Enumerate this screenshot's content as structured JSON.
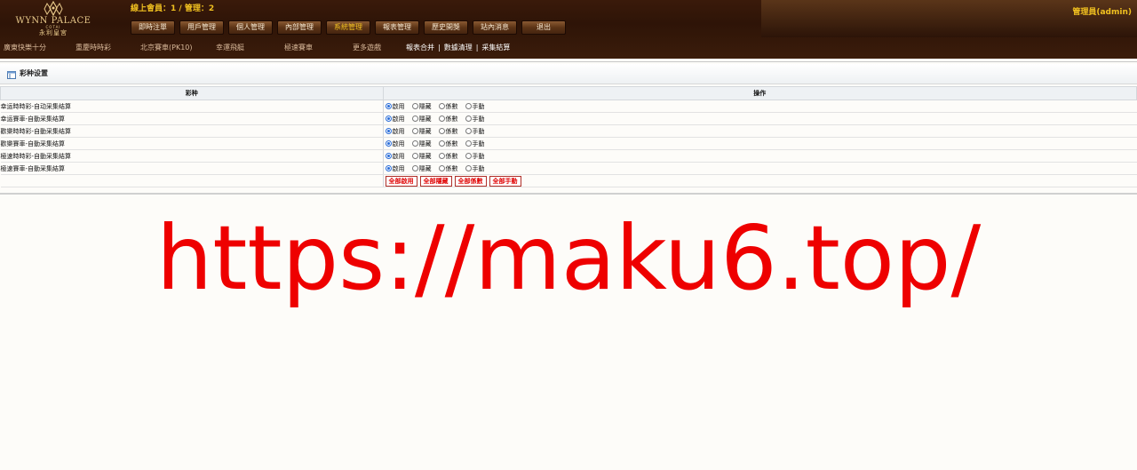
{
  "header": {
    "logo": {
      "brand_en": "WYNN PALACE",
      "brand_sub": "COTAI",
      "brand_cn": "永利皇宮"
    },
    "online_status": "線上會員：1 / 管理：2",
    "admin_label": "管理員(admin)"
  },
  "nav": [
    {
      "label": "即時注單",
      "active": false
    },
    {
      "label": "用戶管理",
      "active": false
    },
    {
      "label": "個人管理",
      "active": false
    },
    {
      "label": "內部管理",
      "active": false
    },
    {
      "label": "系統管理",
      "active": true
    },
    {
      "label": "報表管理",
      "active": false
    },
    {
      "label": "歷史開獎",
      "active": false
    },
    {
      "label": "站內消息",
      "active": false
    },
    {
      "label": "退出",
      "active": false
    }
  ],
  "lottery_links": [
    "廣東快樂十分",
    "重慶時時彩",
    "北京賽車(PK10)",
    "幸運飛艇",
    "極速賽車",
    "更多遊戲"
  ],
  "subnav_links": [
    "報表合并",
    "數據清理",
    "采集結算"
  ],
  "panel": {
    "title": "彩种设置",
    "columns": [
      "彩种",
      "操作"
    ],
    "option_labels": [
      "啟用",
      "隱藏",
      "係數",
      "手動"
    ],
    "rows": [
      {
        "name": "幸运時時彩-自动采集结算",
        "selected": 0
      },
      {
        "name": "幸运賽車-自動采集结算",
        "selected": 0
      },
      {
        "name": "歡樂時時彩-自動采集结算",
        "selected": 0
      },
      {
        "name": "歡樂賽車-自動采集结算",
        "selected": 0
      },
      {
        "name": "極速時時彩-自動采集結算",
        "selected": 0
      },
      {
        "name": "極速賽車-自動采集結算",
        "selected": 0
      }
    ],
    "bulk_buttons": [
      "全部啟用",
      "全部隱藏",
      "全部係數",
      "全部手動"
    ]
  },
  "watermark": "https://maku6.top/",
  "colors": {
    "header_bg": "#2e1407",
    "accent_gold": "#f0c020",
    "link_tan": "#d9b99a",
    "radio_blue": "#2a6dd9",
    "bulk_red": "#e00000",
    "watermark_red": "#ee0000"
  }
}
